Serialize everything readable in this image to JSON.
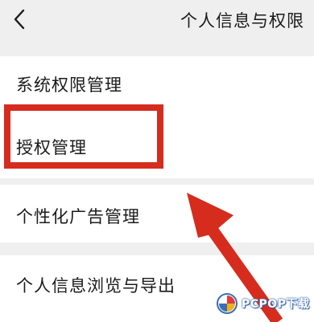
{
  "header": {
    "back_icon": "chevron-left-icon",
    "title": "个人信息与权限"
  },
  "items": [
    {
      "label": "系统权限管理"
    },
    {
      "label": "授权管理"
    },
    {
      "label": "个性化广告管理"
    },
    {
      "label": "个人信息浏览与导出"
    }
  ],
  "annotation": {
    "highlight_color": "#d62c1e",
    "arrow_color": "#d62c1e",
    "highlighted_item": "授权管理"
  },
  "watermark": {
    "text": "PCPOP下载",
    "logo_colors": [
      "#3a6fb8",
      "#e03a3a",
      "#f2b01e"
    ]
  }
}
